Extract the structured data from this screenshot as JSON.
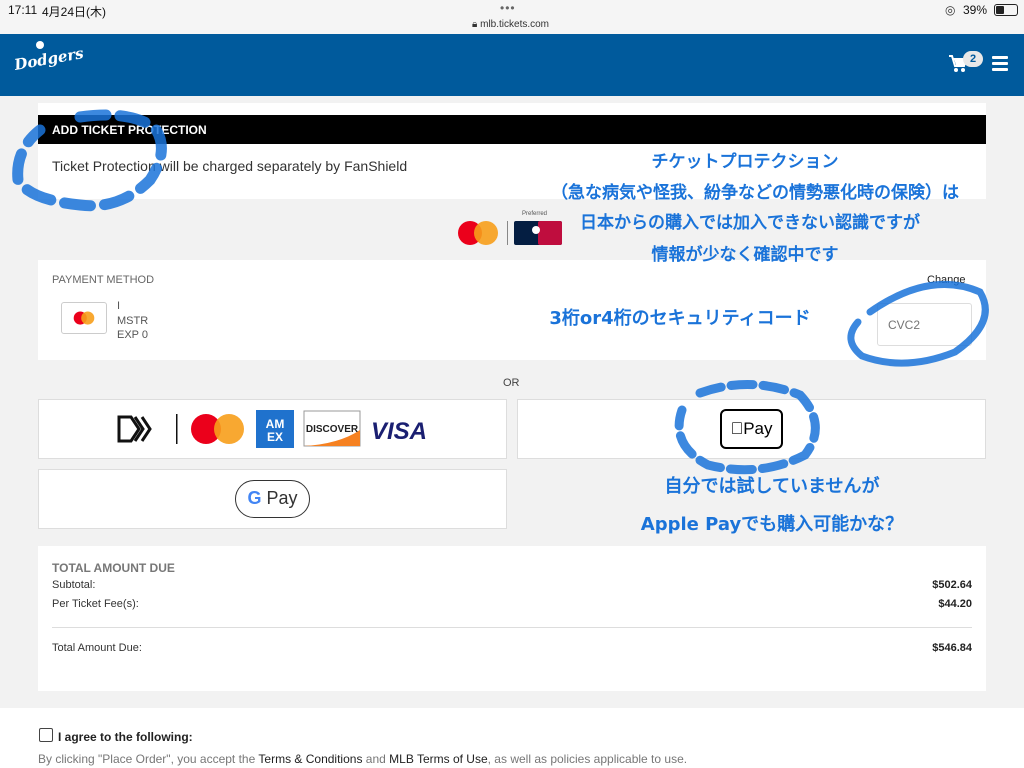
{
  "status_bar": {
    "time": "17:11",
    "date": "4月24日(木)",
    "url": "mlb.tickets.com",
    "battery": "39%"
  },
  "header": {
    "logo_text": "Dodgers",
    "cart_count": "2",
    "brand_color": "#005a9c"
  },
  "protection": {
    "heading": "ADD TICKET PROTECTION",
    "text": "Ticket Protection will be charged separately by FanShield",
    "preferred_label": "Preferred"
  },
  "payment_method": {
    "label": "PAYMENT METHOD",
    "change": "Change",
    "card_number": "I",
    "card_brand": "MSTR",
    "exp": "EXP 0",
    "cvc_placeholder": "CVC2"
  },
  "or_label": "OR",
  "wallets": {
    "card_brands": [
      "MASTERCARD",
      "AMEX",
      "DISCOVER",
      "VISA"
    ],
    "apple_pay": "Pay",
    "google_pay_g": "G",
    "google_pay": "Pay"
  },
  "totals": {
    "title": "TOTAL AMOUNT DUE",
    "subtotal_label": "Subtotal:",
    "subtotal_value": "$502.64",
    "fee_label": "Per Ticket Fee(s):",
    "fee_value": "$44.20",
    "due_label": "Total Amount Due:",
    "due_value": "$546.84"
  },
  "agree": {
    "label": "I agree to the following:",
    "legal_pre": "By clicking \"Place Order\", you accept the ",
    "terms": "Terms & Conditions",
    "and": " and ",
    "mlb_terms": "MLB Terms of Use",
    "legal_post": ", as well as policies applicable to use."
  },
  "annotations": {
    "line1": "チケットプロテクション",
    "line2": "（急な病気や怪我、紛争などの情勢悪化時の保険）は",
    "line3": "日本からの購入では加入できない認識ですが",
    "line4": "情報が少なく確認中です",
    "cvc_note": "3桁or4桁のセキュリティコード",
    "apple_note1": "自分では試していませんが",
    "apple_note2": "Apple Payでも購入可能かな？",
    "color": "#1a73d9"
  }
}
